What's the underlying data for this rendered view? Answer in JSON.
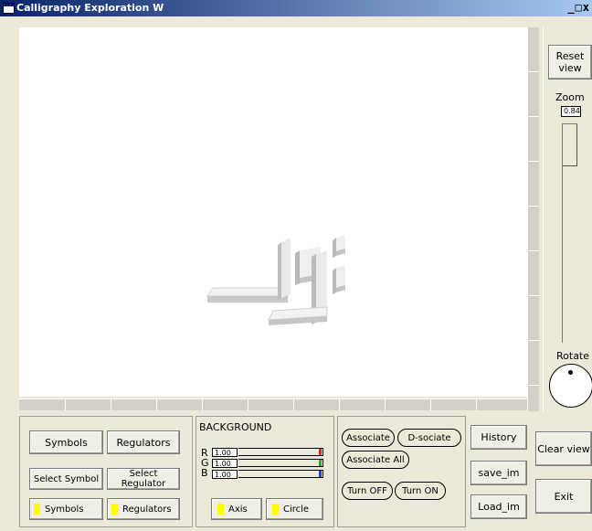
{
  "window": {
    "title": "Calligraphy Exploration W",
    "controls": "_□x"
  },
  "right_panel": {
    "reset_view": "Reset view",
    "zoom_label": "Zoom",
    "zoom_value": "0.84",
    "rotate_label": "Rotate"
  },
  "symbols_panel": {
    "symbols_button": "Symbols",
    "regulators_button": "Regulators",
    "select_symbol_button": "Select Symbol",
    "select_regulator_button": "Select Regulator",
    "symbols_toggle": "Symbols",
    "regulators_toggle": "Regulators"
  },
  "background_panel": {
    "title": "BACKGROUND",
    "r_label": "R",
    "g_label": "G",
    "b_label": "B",
    "r_value": "1.00",
    "g_value": "1.00",
    "b_value": "1.00",
    "axis_toggle": "Axis",
    "circle_toggle": "Circle",
    "colors": {
      "r": "#e02020",
      "g": "#20b020",
      "b": "#2040e0"
    }
  },
  "associate_panel": {
    "associate": "Associate",
    "dissociate": "D-sociate",
    "associate_all": "Associate All",
    "turn_off": "Turn OFF",
    "turn_on": "Turn ON"
  },
  "file_panel": {
    "history": "History",
    "save": "save_im",
    "load": "Load_im"
  },
  "actions": {
    "clear_view": "Clear view",
    "exit": "Exit"
  }
}
